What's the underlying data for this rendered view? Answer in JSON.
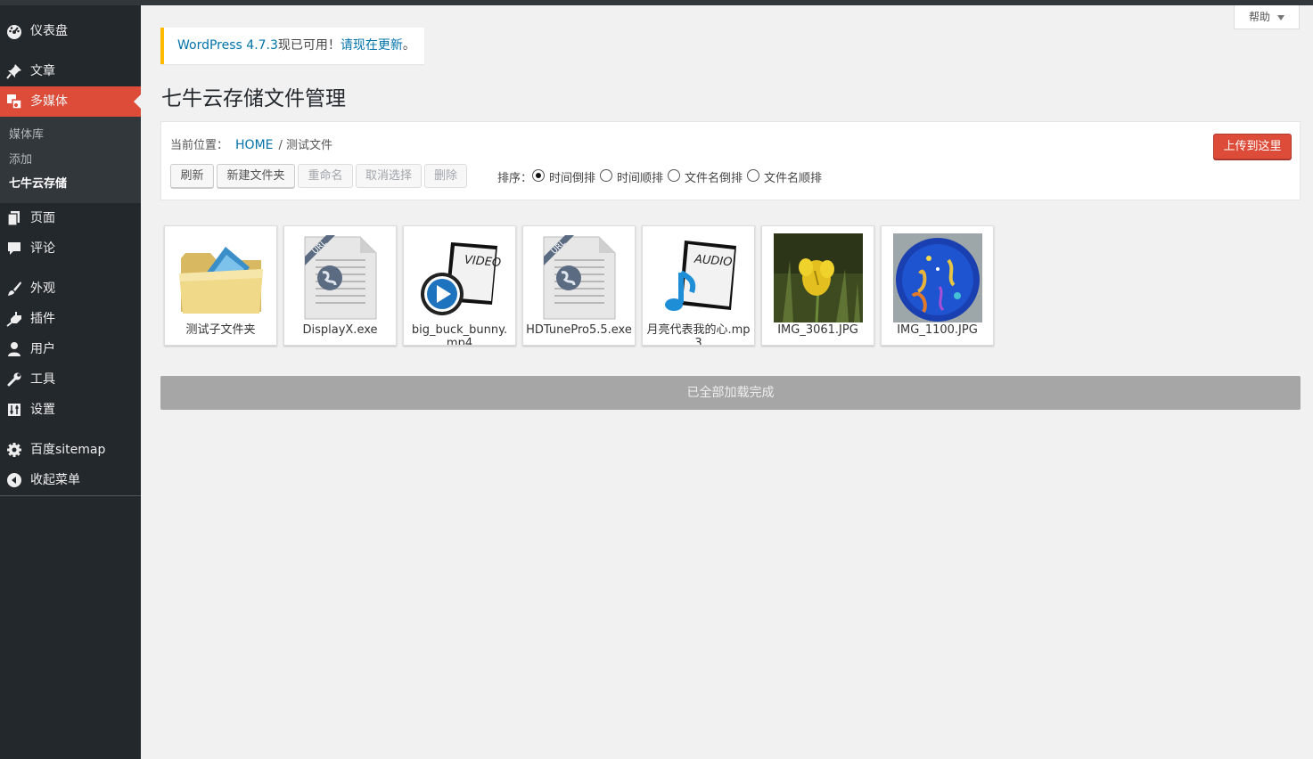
{
  "sidebar": {
    "items": [
      {
        "label": "仪表盘",
        "icon": "dashboard-icon"
      },
      {
        "label": "文章",
        "icon": "pin-icon"
      },
      {
        "label": "多媒体",
        "icon": "media-icon"
      },
      {
        "label": "页面",
        "icon": "page-icon"
      },
      {
        "label": "评论",
        "icon": "comment-icon"
      },
      {
        "label": "外观",
        "icon": "brush-icon"
      },
      {
        "label": "插件",
        "icon": "plugin-icon"
      },
      {
        "label": "用户",
        "icon": "user-icon"
      },
      {
        "label": "工具",
        "icon": "wrench-icon"
      },
      {
        "label": "设置",
        "icon": "settings-icon"
      },
      {
        "label": "百度sitemap",
        "icon": "gear-icon"
      },
      {
        "label": "收起菜单",
        "icon": "collapse-icon"
      }
    ],
    "submenu": [
      "媒体库",
      "添加",
      "七牛云存储"
    ]
  },
  "help": {
    "label": "帮助"
  },
  "notice": {
    "version_text": "WordPress 4.7.3",
    "middle": "现已可用！",
    "link": "请现在更新",
    "end": "。"
  },
  "page_title": "七牛云存储文件管理",
  "breadcrumb": {
    "label": "当前位置：",
    "home": "HOME",
    "sep": "/",
    "current": "测试文件"
  },
  "toolbar": {
    "refresh": "刷新",
    "new_folder": "新建文件夹",
    "rename": "重命名",
    "deselect": "取消选择",
    "delete": "删除",
    "upload": "上传到这里"
  },
  "sort": {
    "label": "排序：",
    "options": [
      "时间倒排",
      "时间顺排",
      "文件名倒排",
      "文件名顺排"
    ],
    "selected": "时间倒排"
  },
  "files": [
    {
      "name": "测试子文件夹",
      "type": "folder"
    },
    {
      "name": "DisplayX.exe",
      "type": "url"
    },
    {
      "name": "big_buck_bunny.mp4",
      "type": "video"
    },
    {
      "name": "HDTunePro5.5.exe",
      "type": "url"
    },
    {
      "name": "月亮代表我的心.mp3",
      "type": "audio"
    },
    {
      "name": "IMG_3061.JPG",
      "type": "image"
    },
    {
      "name": "IMG_1100.JPG",
      "type": "image"
    }
  ],
  "load_status": "已全部加载完成",
  "colors": {
    "accent": "#dd4b39",
    "sidebar": "#23282d",
    "link": "#0073aa",
    "notice_border": "#ffb900"
  }
}
